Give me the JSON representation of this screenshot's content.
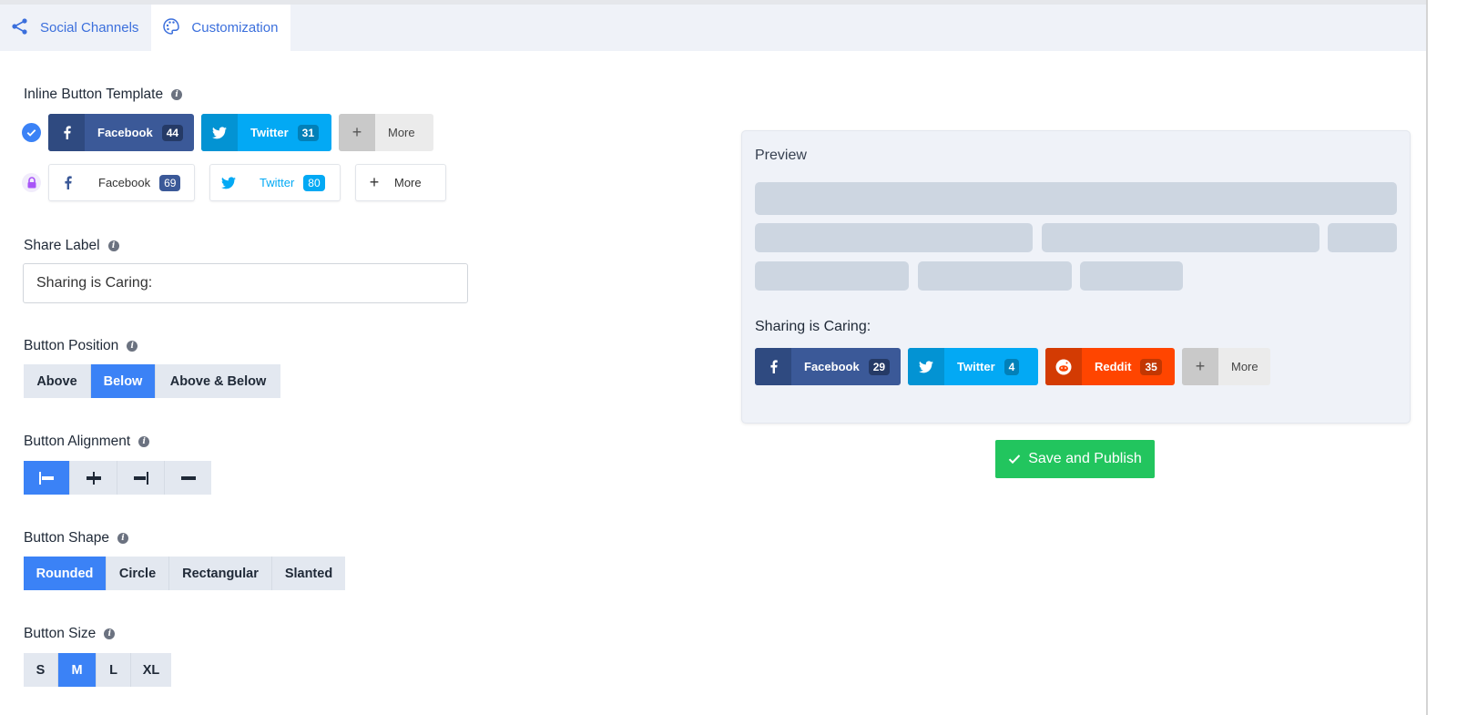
{
  "tabs": [
    {
      "label": "Social Channels",
      "icon": "share-icon",
      "active": false
    },
    {
      "label": "Customization",
      "icon": "palette-icon",
      "active": true
    }
  ],
  "inline_template": {
    "label": "Inline Button Template",
    "rows": [
      {
        "status": "selected",
        "buttons": [
          {
            "network": "Facebook",
            "count": "44"
          },
          {
            "network": "Twitter",
            "count": "31"
          },
          {
            "network": "More",
            "count": null
          }
        ]
      },
      {
        "status": "locked",
        "buttons": [
          {
            "network": "Facebook",
            "count": "69"
          },
          {
            "network": "Twitter",
            "count": "80"
          },
          {
            "network": "More",
            "count": null
          }
        ]
      }
    ]
  },
  "share_label": {
    "label": "Share Label",
    "value": "Sharing is Caring:"
  },
  "button_position": {
    "label": "Button Position",
    "options": [
      "Above",
      "Below",
      "Above & Below"
    ],
    "selected": "Below"
  },
  "button_alignment": {
    "label": "Button Alignment",
    "options": [
      "align-left-icon",
      "align-center-icon",
      "align-right-icon",
      "align-stretch-icon"
    ],
    "selected": "align-left-icon"
  },
  "button_shape": {
    "label": "Button Shape",
    "options": [
      "Rounded",
      "Circle",
      "Rectangular",
      "Slanted"
    ],
    "selected": "Rounded"
  },
  "button_size": {
    "label": "Button Size",
    "options": [
      "S",
      "M",
      "L",
      "XL"
    ],
    "selected": "M"
  },
  "preview": {
    "title": "Preview",
    "share_label": "Sharing is Caring:",
    "buttons": [
      {
        "network": "Facebook",
        "count": "29"
      },
      {
        "network": "Twitter",
        "count": "4"
      },
      {
        "network": "Reddit",
        "count": "35"
      },
      {
        "network": "More",
        "count": null
      }
    ]
  },
  "actions": {
    "save_label": "Save and Publish"
  },
  "colors": {
    "accent": "#3b82f6",
    "facebook": "#3b5998",
    "twitter": "#03a9f4",
    "reddit": "#ff4500",
    "save": "#22c55e"
  }
}
